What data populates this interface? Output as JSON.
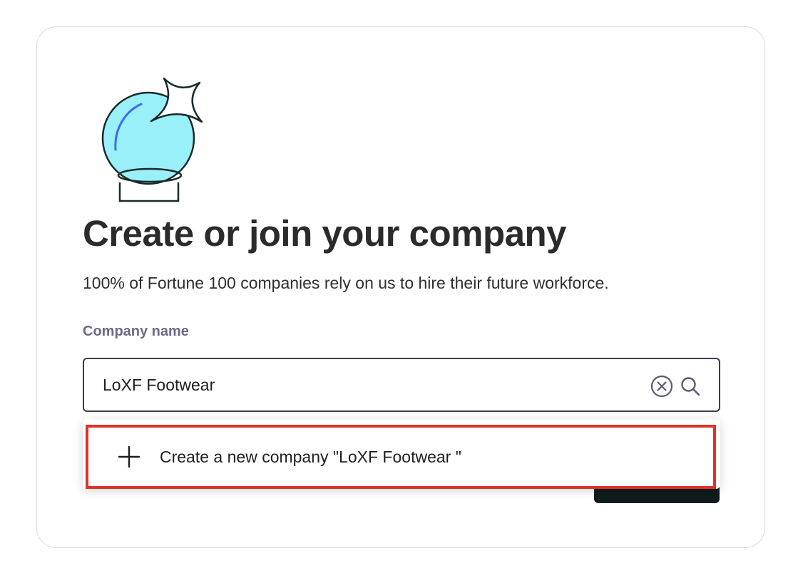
{
  "page": {
    "title": "Create or join your company",
    "subtitle": "100% of Fortune 100 companies rely on us to hire their future workforce."
  },
  "illustration": {
    "icon": "crystal-ball-sparkle-icon",
    "colors": {
      "ball": "#99f0f8",
      "outline": "#1a2a2a",
      "highlight": "#3a6cf0"
    }
  },
  "form": {
    "company_field": {
      "label": "Company name",
      "value": "LoXF Footwear",
      "clear_icon": "clear-circle-icon",
      "search_icon": "search-icon"
    }
  },
  "dropdown": {
    "options": [
      {
        "icon": "plus-icon",
        "label": "Create a new company \"LoXF Footwear \""
      }
    ],
    "highlight_color": "#e03327"
  },
  "colors": {
    "title": "#2b2b2b",
    "label": "#6b6a87",
    "input_border": "#3d3c55",
    "button_bg": "#0f1c1c"
  }
}
